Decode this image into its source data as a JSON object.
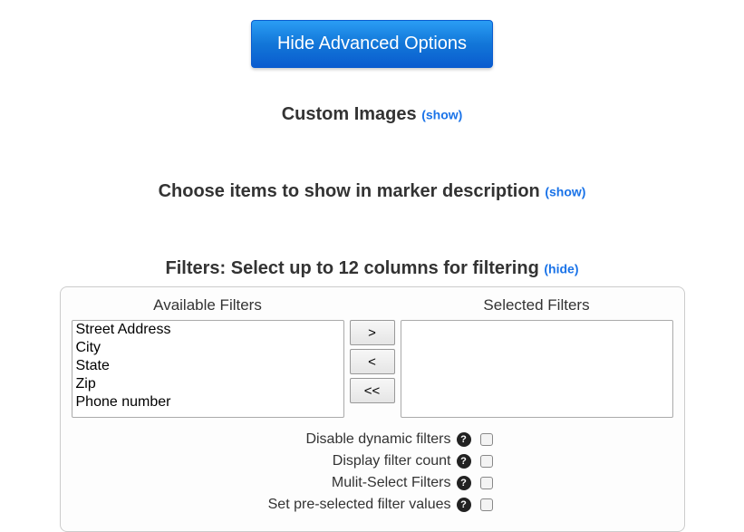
{
  "toggle_button": {
    "label": "Hide Advanced Options"
  },
  "sections": {
    "custom_images": {
      "title": "Custom Images",
      "toggle": "(show)"
    },
    "marker_desc": {
      "title": "Choose items to show in marker description",
      "toggle": "(show)"
    },
    "filters": {
      "title": "Filters: Select up to 12 columns for filtering",
      "toggle": "(hide)"
    }
  },
  "filters_panel": {
    "available_label": "Available Filters",
    "selected_label": "Selected Filters",
    "available_options": [
      "Street Address",
      "City",
      "State",
      "Zip",
      "Phone number"
    ],
    "selected_options": [],
    "move_right": ">",
    "move_left": "<",
    "move_all_left": "<<",
    "options": {
      "disable_dynamic": {
        "label": "Disable dynamic filters",
        "checked": false
      },
      "display_count": {
        "label": "Display filter count",
        "checked": false
      },
      "multi_select": {
        "label": "Mulit-Select Filters",
        "checked": false
      },
      "preselected": {
        "label": "Set pre-selected filter values",
        "checked": false
      }
    },
    "help_glyph": "?"
  }
}
